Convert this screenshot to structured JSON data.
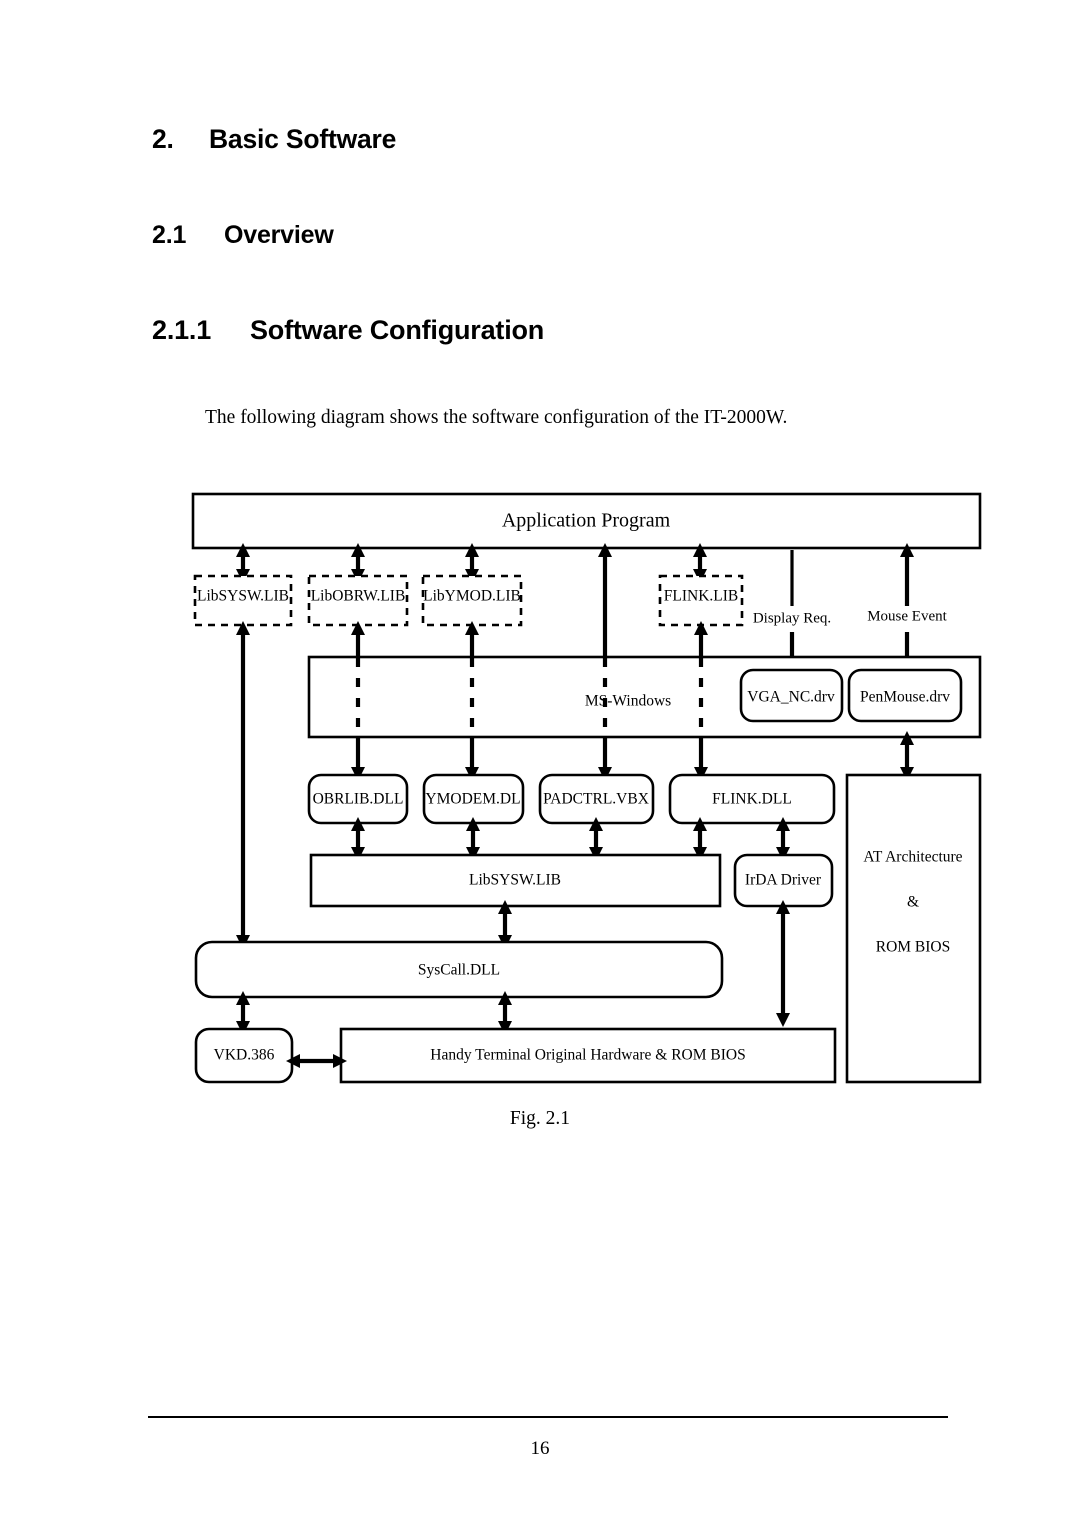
{
  "headings": {
    "chapter_number": "2.",
    "chapter_title": "Basic Software",
    "section_number": "2.1",
    "section_title": "Overview",
    "subsection_number": "2.1.1",
    "subsection_title": "Software Configuration"
  },
  "body": {
    "intro": "The following diagram shows the software configuration of the IT-2000W."
  },
  "figure": {
    "caption": "Fig. 2.1",
    "boxes": {
      "application_program": "Application Program",
      "lib_sysw_top": "LibSYSW.LIB",
      "lib_obrw": "LibOBRW.LIB",
      "lib_ymod": "LibYMOD.LIB",
      "flink_lib": "FLINK.LIB",
      "ms_windows": "MS-Windows",
      "vga_nc_drv": "VGA_NC.drv",
      "penmouse_drv": "PenMouse.drv",
      "obrlib_dll": "OBRLIB.DLL",
      "ymodem_dl": "YMODEM.DL",
      "padctrl_vbx": "PADCTRL.VBX",
      "flink_dll": "FLINK.DLL",
      "lib_sysw_mid": "LibSYSW.LIB",
      "irda_driver": "IrDA Driver",
      "syscall_dll": "SysCall.DLL",
      "vkd_386": "VKD.386",
      "handy_terminal": "Handy Terminal Original Hardware & ROM BIOS",
      "at_arch_line1": "AT Architecture",
      "at_arch_line2": "&",
      "at_arch_line3": "ROM BIOS"
    },
    "edge_labels": {
      "display_req": "Display Req.",
      "mouse_event": "Mouse Event"
    }
  },
  "footer": {
    "page_number": "16"
  }
}
